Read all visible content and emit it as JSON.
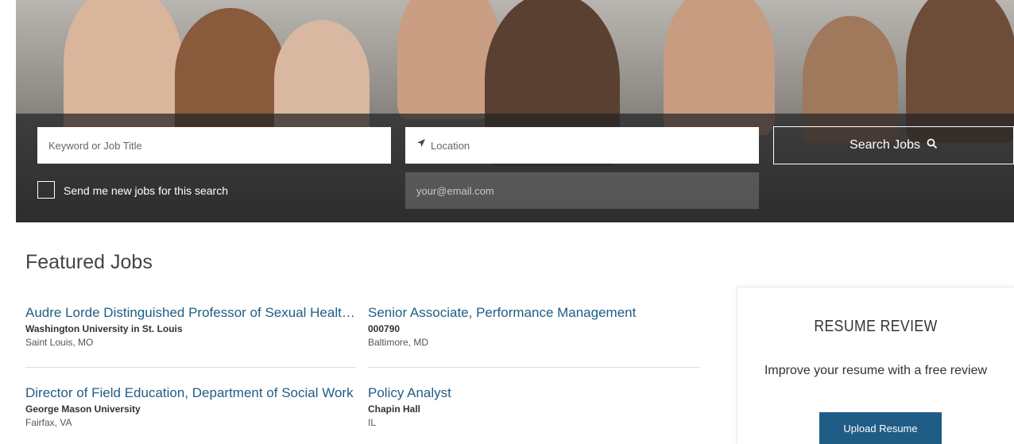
{
  "search": {
    "keyword_placeholder": "Keyword or Job Title",
    "location_placeholder": "Location",
    "email_placeholder": "your@email.com",
    "search_button": "Search Jobs",
    "alert_label": "Send me new jobs for this search",
    "location_icon": "location-arrow-icon",
    "search_icon": "magnifier-icon"
  },
  "featured": {
    "heading": "Featured Jobs",
    "jobs": [
      {
        "title": "Audre Lorde Distinguished Professor of Sexual Health and Social Justice",
        "company": "Washington University in St. Louis",
        "location": "Saint Louis, MO"
      },
      {
        "title": "Senior Associate, Performance Management",
        "company": "000790",
        "location": "Baltimore, MD"
      },
      {
        "title": "Director of Field Education, Department of Social Work",
        "company": "George Mason University",
        "location": "Fairfax, VA"
      },
      {
        "title": "Policy Analyst",
        "company": "Chapin Hall",
        "location": "IL"
      }
    ]
  },
  "resume": {
    "heading": "RESUME REVIEW",
    "text": "Improve your resume with a free review",
    "button": "Upload Resume"
  },
  "colors": {
    "link": "#1f5d86",
    "button": "#1f5d86",
    "overlay": "#232326"
  }
}
